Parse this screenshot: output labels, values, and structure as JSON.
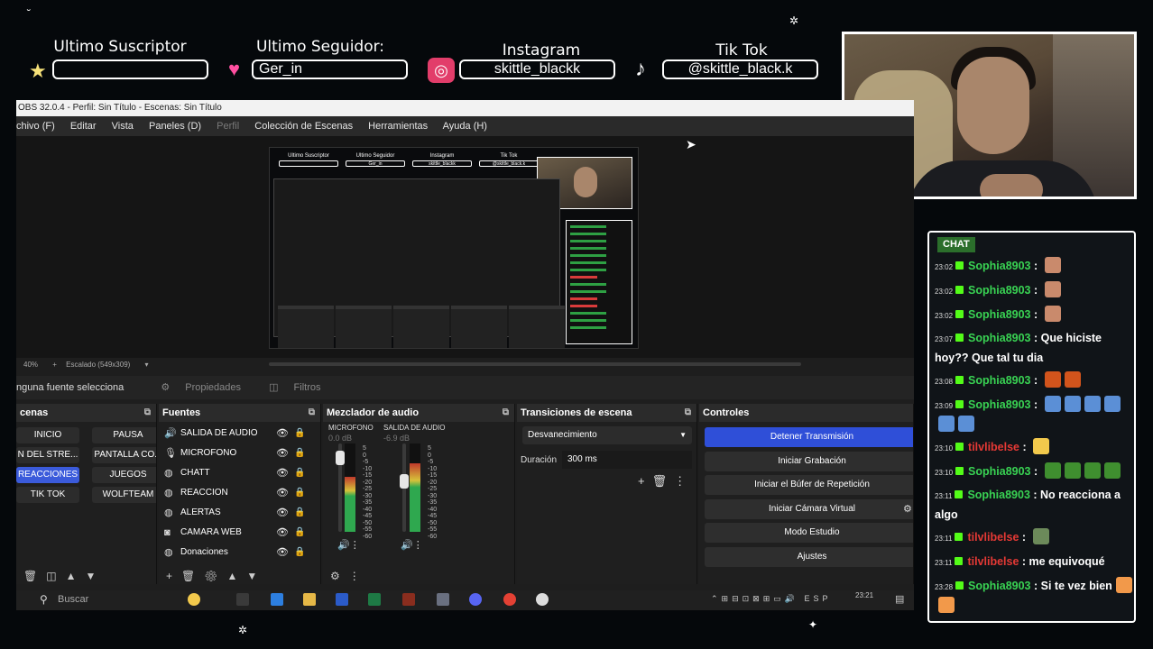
{
  "overlay": {
    "suscriptor_label": "Ultimo Suscriptor",
    "suscriptor_value": "",
    "seguidor_label": "Ultimo Seguidor:",
    "seguidor_value": "Ger_in",
    "instagram_label": "Instagram",
    "instagram_value": "skittle_blackk",
    "tiktok_label": "Tik Tok",
    "tiktok_value": "@skittle_black.k",
    "icons": [
      "star-icon",
      "heart-icon",
      "instagram-icon",
      "tiktok-icon"
    ]
  },
  "obs": {
    "title": "OBS 32.0.4 - Perfil: Sin Título - Escenas: Sin Título",
    "menu": [
      "chivo (F)",
      "Editar",
      "Vista",
      "Paneles (D)",
      "Perfil",
      "Colección de Escenas",
      "Herramientas",
      "Ayuda (H)"
    ],
    "zoom": "40%",
    "scaling": "Escalado (549x309)",
    "no_source": "nguna fuente selecciona",
    "properties_label": "Propiedades",
    "filters_label": "Filtros",
    "docks": {
      "scenes_title": "cenas",
      "sources_title": "Fuentes",
      "mixer_title": "Mezclador de audio",
      "transitions_title": "Transiciones de escena",
      "controls_title": "Controles"
    },
    "scenes": [
      "INICIO",
      "PAUSA",
      "N DEL STRE...",
      "PANTALLA CO...",
      "REACCIONES",
      "JUEGOS",
      "TIK TOK",
      "WOLFTEAM"
    ],
    "active_scene": "REACCIONES",
    "sources": [
      {
        "icon": "speaker-icon",
        "label": "SALIDA DE AUDIO"
      },
      {
        "icon": "mic-icon",
        "label": "MICROFONO"
      },
      {
        "icon": "globe-icon",
        "label": "CHATT"
      },
      {
        "icon": "globe-icon",
        "label": "REACCION"
      },
      {
        "icon": "globe-icon",
        "label": "ALERTAS"
      },
      {
        "icon": "camera-icon",
        "label": "CAMARA WEB"
      },
      {
        "icon": "globe-icon",
        "label": "Donaciones"
      }
    ],
    "mixer": [
      {
        "name": "MICROFONO",
        "db": "0.0 dB",
        "level": 0.62
      },
      {
        "name": "SALIDA DE AUDIO",
        "db": "-6.9 dB",
        "level": 0.78
      }
    ],
    "mixer_scale": [
      "5",
      "0",
      "-5",
      "-10",
      "-15",
      "-20",
      "-25",
      "-30",
      "-35",
      "-40",
      "-45",
      "-50",
      "-55",
      "-60"
    ],
    "transition": "Desvanecimiento",
    "duration_label": "Duración",
    "duration_value": "300 ms",
    "controls": [
      "Detener Transmisión",
      "Iniciar Grabación",
      "Iniciar el Búfer de Repetición",
      "Iniciar Cámara Virtual",
      "Modo Estudio",
      "Ajustes"
    ],
    "taskbar_search": "Buscar",
    "tray_lang": "ESP",
    "clock_time": "23:21"
  },
  "chat": {
    "title": "CHAT",
    "messages": [
      {
        "time": "23:02",
        "user": "Sophia8903",
        "text": "",
        "red": false,
        "emotes": [
          "#c98a6c"
        ]
      },
      {
        "time": "23:02",
        "user": "Sophia8903",
        "text": "",
        "red": false,
        "emotes": [
          "#c98a6c"
        ]
      },
      {
        "time": "23:02",
        "user": "Sophia8903",
        "text": "",
        "red": false,
        "emotes": [
          "#c98a6c"
        ]
      },
      {
        "time": "23:07",
        "user": "Sophia8903",
        "text": "Que hiciste hoy?? Que tal tu dia",
        "red": false,
        "emotes": []
      },
      {
        "time": "23:08",
        "user": "Sophia8903",
        "text": "",
        "red": false,
        "emotes": [
          "#d2541c",
          "#d2541c"
        ]
      },
      {
        "time": "23:09",
        "user": "Sophia8903",
        "text": "",
        "red": false,
        "emotes": [
          "#5b8fd6",
          "#5b8fd6",
          "#5b8fd6",
          "#5b8fd6",
          "#5b8fd6",
          "#5b8fd6"
        ]
      },
      {
        "time": "23:10",
        "user": "tilvlibelse",
        "text": "",
        "red": true,
        "emotes": [
          "#f2c94c"
        ]
      },
      {
        "time": "23:10",
        "user": "Sophia8903",
        "text": "",
        "red": false,
        "emotes": [
          "#3f8f2f",
          "#3f8f2f",
          "#3f8f2f",
          "#3f8f2f"
        ]
      },
      {
        "time": "23:11",
        "user": "Sophia8903",
        "text": "No reacciona a algo",
        "red": false,
        "emotes": []
      },
      {
        "time": "23:11",
        "user": "tilvlibelse",
        "text": "",
        "red": true,
        "emotes": [
          "#6c8a5a"
        ]
      },
      {
        "time": "23:11",
        "user": "tilvlibelse",
        "text": "me equivoqué",
        "red": true,
        "emotes": []
      },
      {
        "time": "23:28",
        "user": "Sophia8903",
        "text": "Si te vez bien",
        "red": false,
        "emotes": [
          "#f2994a",
          "#f2994a"
        ]
      }
    ]
  }
}
